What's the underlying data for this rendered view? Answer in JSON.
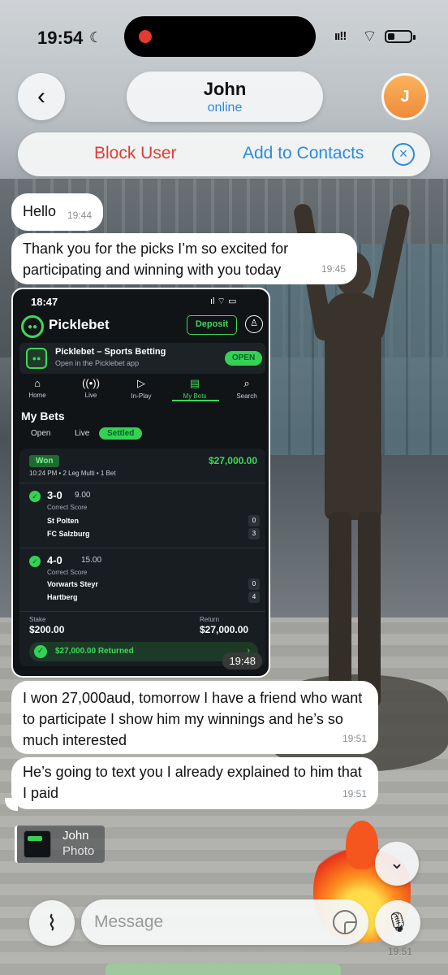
{
  "status": {
    "time": "19:54"
  },
  "header": {
    "name": "John",
    "status": "online",
    "avatar_letter": "J"
  },
  "actions": {
    "block": "Block User",
    "add": "Add to Contacts",
    "close": "⊗"
  },
  "messages": [
    {
      "text": "Hello",
      "time": "19:44"
    },
    {
      "text": "Thank you for the picks I’m so excited for participating and winning with you today",
      "time": "19:45"
    },
    {
      "text": "I won 27,000aud, tomorrow I have a friend who want to participate I show him my winnings and he’s so much interested",
      "time": "19:51"
    },
    {
      "text": "He’s going to text you I already explained to him that I paid",
      "time": "19:51"
    }
  ],
  "photo": {
    "time_label": "19:48",
    "phone_time": "18:47",
    "brand": "Picklebet",
    "deposit": "Deposit",
    "app_title": "Picklebet – Sports Betting",
    "app_sub": "Open in the Picklebet app",
    "open": "OPEN",
    "nav": [
      "Home",
      "Live",
      "In-Play",
      "My Bets",
      "Search"
    ],
    "heading": "My Bets",
    "tabs": [
      "Open",
      "Live",
      "Settled"
    ],
    "won": "Won",
    "amount": "$27,000.00",
    "meta": "10:24 PM  •  2 Leg Multi  •  1 Bet",
    "legs": [
      {
        "score": "3-0",
        "odds": "9.00",
        "market": "Correct Score",
        "team1": "St Polten",
        "g1": "0",
        "team2": "FC Salzburg",
        "g2": "3"
      },
      {
        "score": "4-0",
        "odds": "15.00",
        "market": "Correct Score",
        "team1": "Vorwarts Steyr",
        "g1": "0",
        "team2": "Hartberg",
        "g2": "4"
      }
    ],
    "stake_label": "Stake",
    "stake": "$200.00",
    "return_label": "Return",
    "return": "$27,000.00",
    "returned": "$27,000.00   Returned"
  },
  "reply": {
    "name": "John",
    "type": "Photo"
  },
  "input": {
    "placeholder": "Message"
  },
  "bottom_time": "19:51"
}
